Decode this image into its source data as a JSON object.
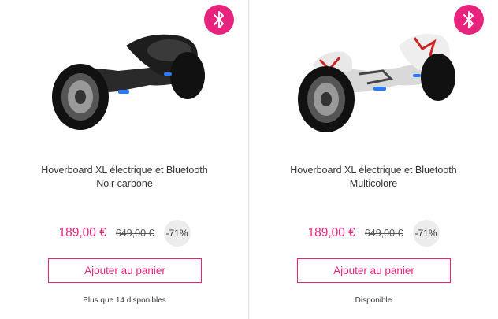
{
  "products": [
    {
      "badge_icon": "bluetooth-icon",
      "name_line1": "Hoverboard XL électrique et Bluetooth",
      "name_line2": "Noir carbone",
      "price": "189,00 €",
      "old_price": "649,00 €",
      "discount": "-71%",
      "add_label": "Ajouter au panier",
      "stock": "Plus que 14 disponibles",
      "variant": "black"
    },
    {
      "badge_icon": "bluetooth-icon",
      "name_line1": "Hoverboard XL électrique et Bluetooth",
      "name_line2": "Multicolore",
      "price": "189,00 €",
      "old_price": "649,00 €",
      "discount": "-71%",
      "add_label": "Ajouter au panier",
      "stock": "Disponible",
      "variant": "multicolor"
    }
  ],
  "colors": {
    "accent": "#e8237d",
    "discount_bg": "#ececec"
  }
}
